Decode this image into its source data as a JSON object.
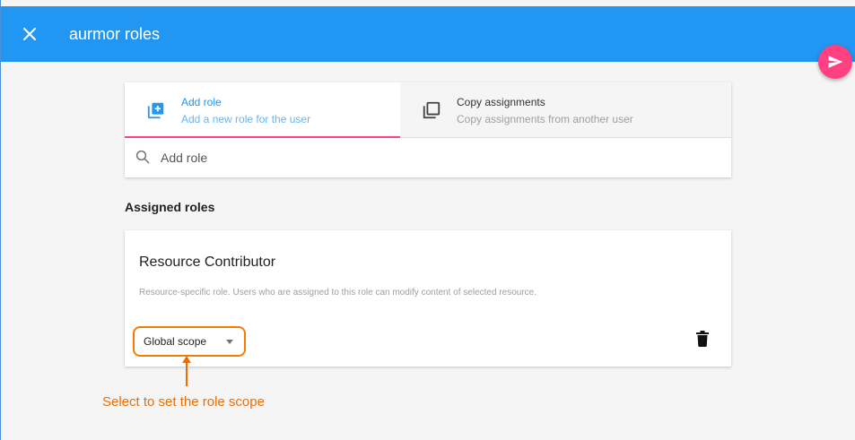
{
  "header": {
    "title": "aurmor roles",
    "bg_color": "#2196f3"
  },
  "fab": {
    "color": "#ff4081",
    "icon": "send-icon"
  },
  "tabs": [
    {
      "label": "Add role",
      "sub": "Add a new role for the user",
      "icon": "add-box-icon",
      "selected": true
    },
    {
      "label": "Copy assignments",
      "sub": "Copy assignments from another user",
      "icon": "copy-icon",
      "selected": false
    }
  ],
  "search": {
    "placeholder": "Add role",
    "icon": "search-icon"
  },
  "assigned": {
    "title": "Assigned roles",
    "roles": [
      {
        "name": "Resource Contributor",
        "description": "Resource-specific role. Users who are assigned to this role can modify content of selected resource.",
        "scope": "Global scope"
      }
    ]
  },
  "annotation": {
    "text": "Select to set the role scope",
    "color": "#ef6c00"
  }
}
